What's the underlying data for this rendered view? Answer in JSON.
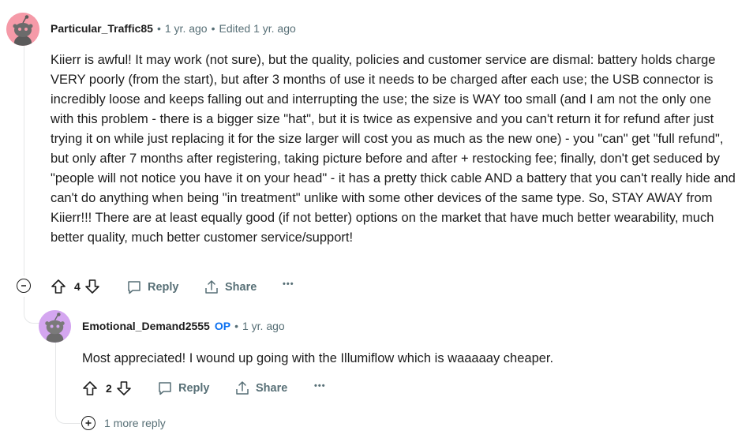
{
  "comment": {
    "author": "Particular_Traffic85",
    "separator": "•",
    "time": "1 yr. ago",
    "edited": "Edited 1 yr. ago",
    "body": "Kiierr is awful! It may work (not sure), but the quality, policies and customer service are dismal: battery holds charge VERY poorly (from the start), but after 3 months of use it needs to be charged after each use; the USB connector is incredibly loose and keeps falling out and interrupting the use; the size is WAY too small (and I am not the only one with this problem - there is a bigger size \"hat\", but it is twice as expensive and you can't return it for refund after just trying it on while just replacing it for the size larger will cost you as much as the new one) - you \"can\" get \"full refund\", but only after 7 months after registering, taking picture before and after + restocking fee; finally, don't get seduced by \"people will not notice you have it on your head\" - it has a pretty thick cable AND a battery that you can't really hide and can't do anything when being \"in treatment\" unlike with some other devices of the same type. So, STAY AWAY from Kiierr!!! There are at least equally good (if not better) options on the market that have much better wearability, much better quality, much better customer service/support!",
    "votes": "4",
    "reply_label": "Reply",
    "share_label": "Share",
    "more_label": "•••",
    "avatar_color": "#f59aa8"
  },
  "reply": {
    "author": "Emotional_Demand2555",
    "op_badge": "OP",
    "separator": "•",
    "time": "1 yr. ago",
    "body": "Most appreciated! I wound up going with the Illumiflow which is waaaaay cheaper.",
    "votes": "2",
    "reply_label": "Reply",
    "share_label": "Share",
    "more_label": "•••",
    "avatar_color": "#d4a6f0"
  },
  "more_replies": "1 more reply",
  "colors": {
    "accent_op": "#0a6ff0",
    "meta": "#576f76",
    "text": "#1c1c1c"
  }
}
